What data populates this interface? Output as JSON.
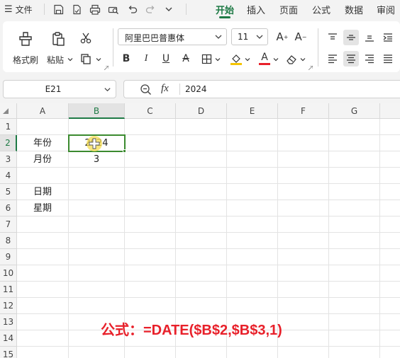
{
  "menu": {
    "file_label": "文件",
    "tabs": [
      "开始",
      "插入",
      "页面",
      "公式",
      "数据",
      "审阅"
    ],
    "active_tab": "开始"
  },
  "ribbon": {
    "format_painter_label": "格式刷",
    "paste_label": "粘贴",
    "font_name": "阿里巴巴普惠体",
    "font_size": "11",
    "accent_color": "#1e7a45",
    "font_color_bar": "#e8202a",
    "highlight_color_bar": "#f5c400"
  },
  "formula_bar": {
    "name_box": "E21",
    "fx_label": "fx",
    "value": "2024"
  },
  "sheet": {
    "columns": [
      "A",
      "B",
      "C",
      "D",
      "E",
      "F",
      "G"
    ],
    "selected_column": "B",
    "rows": [
      "1",
      "2",
      "3",
      "4",
      "5",
      "6",
      "7",
      "8",
      "9",
      "10",
      "11",
      "12",
      "13",
      "14",
      "15"
    ],
    "selected_row": "2",
    "cells": {
      "A2": "年份",
      "B2": "2024",
      "A3": "月份",
      "B3": "3",
      "A5": "日期",
      "A6": "星期"
    }
  },
  "annotation": "公式：=DATE($B$2,$B$3,1)",
  "annotation_color": "#e8202a"
}
